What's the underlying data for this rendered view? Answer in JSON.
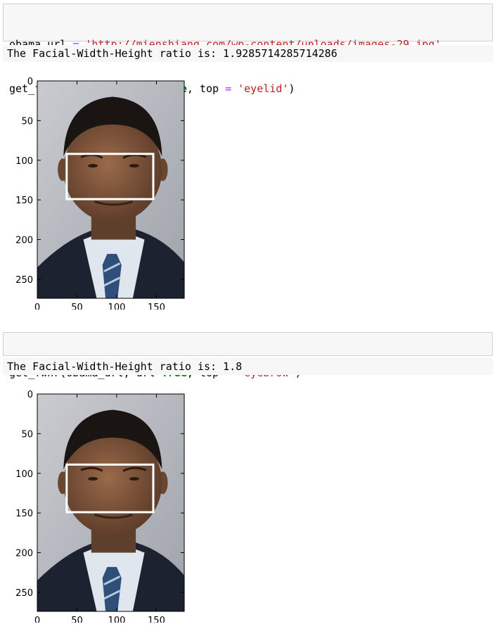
{
  "cells": [
    {
      "code_lines": [
        [
          {
            "text": "obama_url ",
            "cls": ""
          },
          {
            "text": "=",
            "cls": "op"
          },
          {
            "text": " ",
            "cls": ""
          },
          {
            "text": "'http://mienshiang.com/wp-content/uploads/images-29.jpg'",
            "cls": "str"
          }
        ],
        [
          {
            "text": "get_fwhr(obama_url, url",
            "cls": ""
          },
          {
            "text": "=",
            "cls": "op"
          },
          {
            "text": "True",
            "cls": "kw"
          },
          {
            "text": ", top ",
            "cls": ""
          },
          {
            "text": "=",
            "cls": "op"
          },
          {
            "text": " ",
            "cls": ""
          },
          {
            "text": "'eyelid'",
            "cls": "str"
          },
          {
            "text": ")",
            "cls": ""
          }
        ]
      ],
      "output_text": "The Facial-Width-Height ratio is: 1.9285714285714286",
      "plot": {
        "y_ticks": [
          "0",
          "50",
          "100",
          "150",
          "200",
          "250"
        ],
        "x_ticks": [
          "0",
          "50",
          "100",
          "150"
        ],
        "box": {
          "x0": 37,
          "x1": 146,
          "y0": 92,
          "y1": 149
        }
      }
    },
    {
      "code_lines": [
        [
          {
            "text": "get_fwhr(obama_url, url",
            "cls": ""
          },
          {
            "text": "=",
            "cls": "op"
          },
          {
            "text": "True",
            "cls": "kw"
          },
          {
            "text": ", top ",
            "cls": ""
          },
          {
            "text": "=",
            "cls": "op"
          },
          {
            "text": " ",
            "cls": ""
          },
          {
            "text": "'eyebrow'",
            "cls": "str"
          },
          {
            "text": ")",
            "cls": ""
          }
        ]
      ],
      "output_text": "The Facial-Width-Height ratio is: 1.8",
      "plot": {
        "y_ticks": [
          "0",
          "50",
          "100",
          "150",
          "200",
          "250"
        ],
        "x_ticks": [
          "0",
          "50",
          "100",
          "150"
        ],
        "box": {
          "x0": 37,
          "x1": 146,
          "y0": 89,
          "y1": 149
        }
      }
    }
  ],
  "colors": {
    "keyword": "#008000",
    "string": "#ba2121",
    "operator": "#aa22ff",
    "cell_bg": "#f7f7f7",
    "cell_border": "#cfcfcf"
  }
}
